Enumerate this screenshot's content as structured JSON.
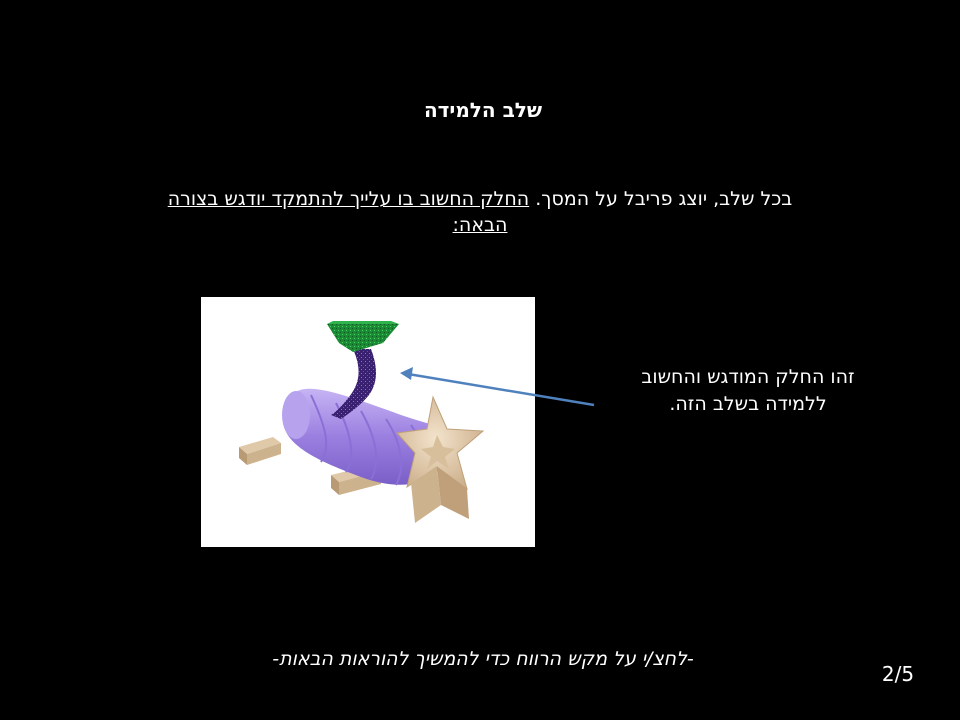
{
  "slide": {
    "title": "שלב הלמידה",
    "intro_plain": "בכל שלב, יוצג פריבל על המסך. ",
    "intro_underlined": "החלק החשוב בו עלייך להתמקד יודגש בצורה הבאה:",
    "callout": "זהו החלק המודגש והחשוב ללמידה בשלב הזה.",
    "instruction": "-לחצ/י על מקש הרווח כדי להמשיך להוראות הבאות-",
    "page_counter": "2/5"
  },
  "colors": {
    "background": "#000000",
    "text": "#ffffff",
    "arrow": "#4f81bd",
    "tube": "#9b7fe0",
    "funnel": "#1f9e3a",
    "neck": "#4a2a8a",
    "star": "#e6cfb0"
  }
}
